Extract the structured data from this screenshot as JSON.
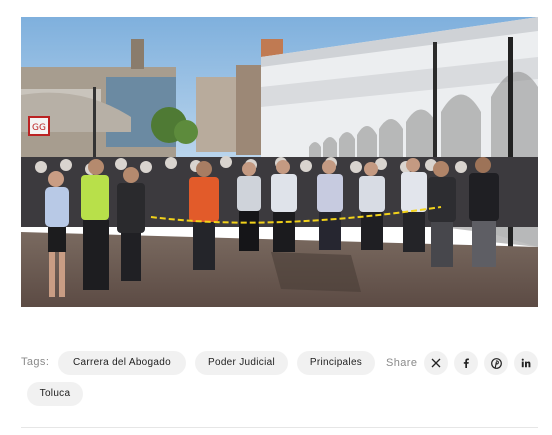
{
  "photo": {
    "alt": "",
    "sign_text": "GG",
    "colors": {
      "sky": "#8fb9e0",
      "building": "#eef0f2",
      "pavement": "#6b5a52"
    }
  },
  "tags": {
    "label": "Tags:",
    "items": [
      "Carrera del Abogado",
      "Poder Judicial",
      "Principales",
      "Toluca"
    ]
  },
  "share": {
    "label": "Share",
    "icons": [
      "x-icon",
      "facebook-icon",
      "pinterest-icon",
      "linkedin-icon"
    ]
  }
}
